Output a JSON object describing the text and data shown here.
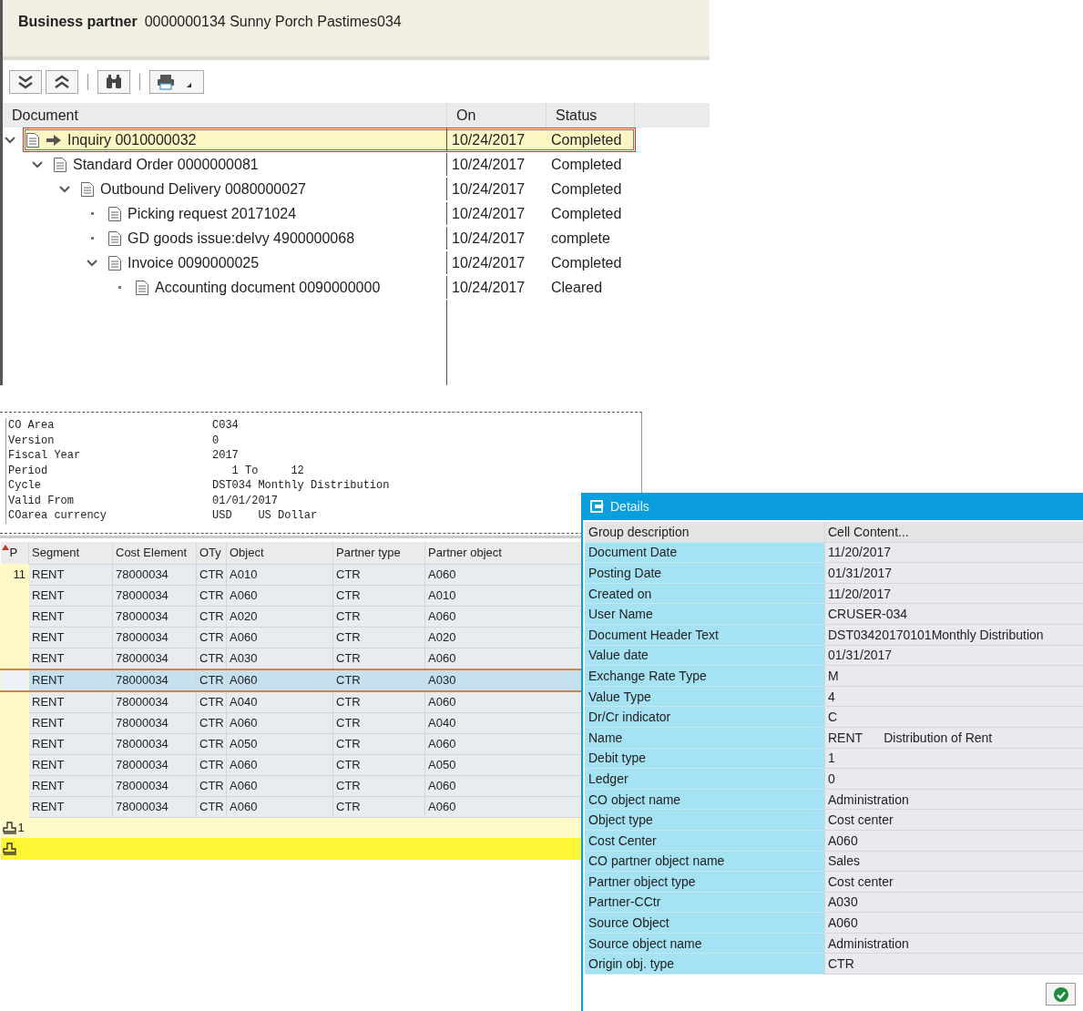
{
  "header": {
    "label": "Business partner",
    "value": "0000000134 Sunny Porch Pastimes034"
  },
  "document_flow": {
    "columns": [
      "Document",
      "On",
      "Status"
    ],
    "nodes": [
      {
        "text": "Inquiry 0010000032",
        "date": "10/24/2017",
        "status": "Completed",
        "selected": true,
        "current": true,
        "expanded": true,
        "children": [
          {
            "text": "Standard Order 0000000081",
            "date": "10/24/2017",
            "status": "Completed",
            "selected": false,
            "current": false,
            "expanded": true,
            "children": [
              {
                "text": "Outbound Delivery 0080000027",
                "date": "10/24/2017",
                "status": "Completed",
                "selected": false,
                "current": false,
                "expanded": true,
                "children": [
                  {
                    "text": "Picking request 20171024",
                    "date": "10/24/2017",
                    "status": "Completed",
                    "selected": false,
                    "current": false,
                    "expanded": false
                  },
                  {
                    "text": "GD goods issue:delvy 4900000068",
                    "date": "10/24/2017",
                    "status": "complete",
                    "selected": false,
                    "current": false,
                    "expanded": false
                  },
                  {
                    "text": "Invoice 0090000025",
                    "date": "10/24/2017",
                    "status": "Completed",
                    "selected": false,
                    "current": false,
                    "expanded": true,
                    "children": [
                      {
                        "text": "Accounting document 0090000000",
                        "date": "10/24/2017",
                        "status": "Cleared",
                        "selected": false,
                        "current": false,
                        "expanded": false
                      }
                    ]
                  }
                ]
              }
            ]
          }
        ]
      }
    ]
  },
  "report_header": [
    {
      "label": "CO Area",
      "value": "C034"
    },
    {
      "label": "Version",
      "value": "0"
    },
    {
      "label": "Fiscal Year",
      "value": "2017"
    },
    {
      "label": "Period",
      "value": "   1 To     12"
    },
    {
      "label": "Cycle",
      "value": "DST034 Monthly Distribution"
    },
    {
      "label": "Valid From",
      "value": "01/01/2017"
    },
    {
      "label": "COarea currency",
      "value": "USD    US Dollar"
    }
  ],
  "line_items": {
    "columns": [
      "P",
      "Segment",
      "Cost Element",
      "OTy",
      "Object",
      "Partner type",
      "Partner object"
    ],
    "rows": [
      {
        "p": "11",
        "segment": "RENT",
        "cost_element": "78000034",
        "oty": "CTR",
        "object": "A010",
        "partner_type": "CTR",
        "partner_object": "A060",
        "selected": false
      },
      {
        "segment": "RENT",
        "cost_element": "78000034",
        "oty": "CTR",
        "object": "A060",
        "partner_type": "CTR",
        "partner_object": "A010",
        "selected": false
      },
      {
        "segment": "RENT",
        "cost_element": "78000034",
        "oty": "CTR",
        "object": "A020",
        "partner_type": "CTR",
        "partner_object": "A060",
        "selected": false
      },
      {
        "segment": "RENT",
        "cost_element": "78000034",
        "oty": "CTR",
        "object": "A060",
        "partner_type": "CTR",
        "partner_object": "A020",
        "selected": false
      },
      {
        "segment": "RENT",
        "cost_element": "78000034",
        "oty": "CTR",
        "object": "A030",
        "partner_type": "CTR",
        "partner_object": "A060",
        "selected": false
      },
      {
        "segment": "RENT",
        "cost_element": "78000034",
        "oty": "CTR",
        "object": "A060",
        "partner_type": "CTR",
        "partner_object": "A030",
        "selected": true
      },
      {
        "segment": "RENT",
        "cost_element": "78000034",
        "oty": "CTR",
        "object": "A040",
        "partner_type": "CTR",
        "partner_object": "A060",
        "selected": false
      },
      {
        "segment": "RENT",
        "cost_element": "78000034",
        "oty": "CTR",
        "object": "A060",
        "partner_type": "CTR",
        "partner_object": "A040",
        "selected": false
      },
      {
        "segment": "RENT",
        "cost_element": "78000034",
        "oty": "CTR",
        "object": "A050",
        "partner_type": "CTR",
        "partner_object": "A060",
        "selected": false
      },
      {
        "segment": "RENT",
        "cost_element": "78000034",
        "oty": "CTR",
        "object": "A060",
        "partner_type": "CTR",
        "partner_object": "A050",
        "selected": false
      },
      {
        "segment": "RENT",
        "cost_element": "78000034",
        "oty": "CTR",
        "object": "A060",
        "partner_type": "CTR",
        "partner_object": "A060",
        "selected": false
      },
      {
        "segment": "RENT",
        "cost_element": "78000034",
        "oty": "CTR",
        "object": "A060",
        "partner_type": "CTR",
        "partner_object": "A060",
        "selected": false
      }
    ],
    "subtotal_count": "1"
  },
  "details": {
    "title": "Details",
    "columns": [
      "Group description",
      "Cell Content..."
    ],
    "rows": [
      {
        "label": "Document Date",
        "value": "11/20/2017"
      },
      {
        "label": "Posting Date",
        "value": "01/31/2017"
      },
      {
        "label": "Created on",
        "value": "11/20/2017"
      },
      {
        "label": "User Name",
        "value": "CRUSER-034"
      },
      {
        "label": "Document Header Text",
        "value": "DST03420170101Monthly Distribution"
      },
      {
        "label": "Value date",
        "value": "01/31/2017"
      },
      {
        "label": "Exchange Rate Type",
        "value": "M"
      },
      {
        "label": "Value Type",
        "value": "4"
      },
      {
        "label": "Dr/Cr indicator",
        "value": "C"
      },
      {
        "label": "Name",
        "value": "RENT      Distribution of Rent"
      },
      {
        "label": "Debit type",
        "value": "1"
      },
      {
        "label": "Ledger",
        "value": "0"
      },
      {
        "label": "CO object name",
        "value": "Administration"
      },
      {
        "label": "Object type",
        "value": "Cost center"
      },
      {
        "label": "Cost Center",
        "value": "A060"
      },
      {
        "label": "CO partner object name",
        "value": "Sales"
      },
      {
        "label": "Partner object type",
        "value": "Cost center"
      },
      {
        "label": "Partner-CCtr",
        "value": "A030"
      },
      {
        "label": "Source Object",
        "value": "A060"
      },
      {
        "label": "Source object name",
        "value": "Administration"
      },
      {
        "label": "Origin obj. type",
        "value": "CTR"
      }
    ]
  }
}
